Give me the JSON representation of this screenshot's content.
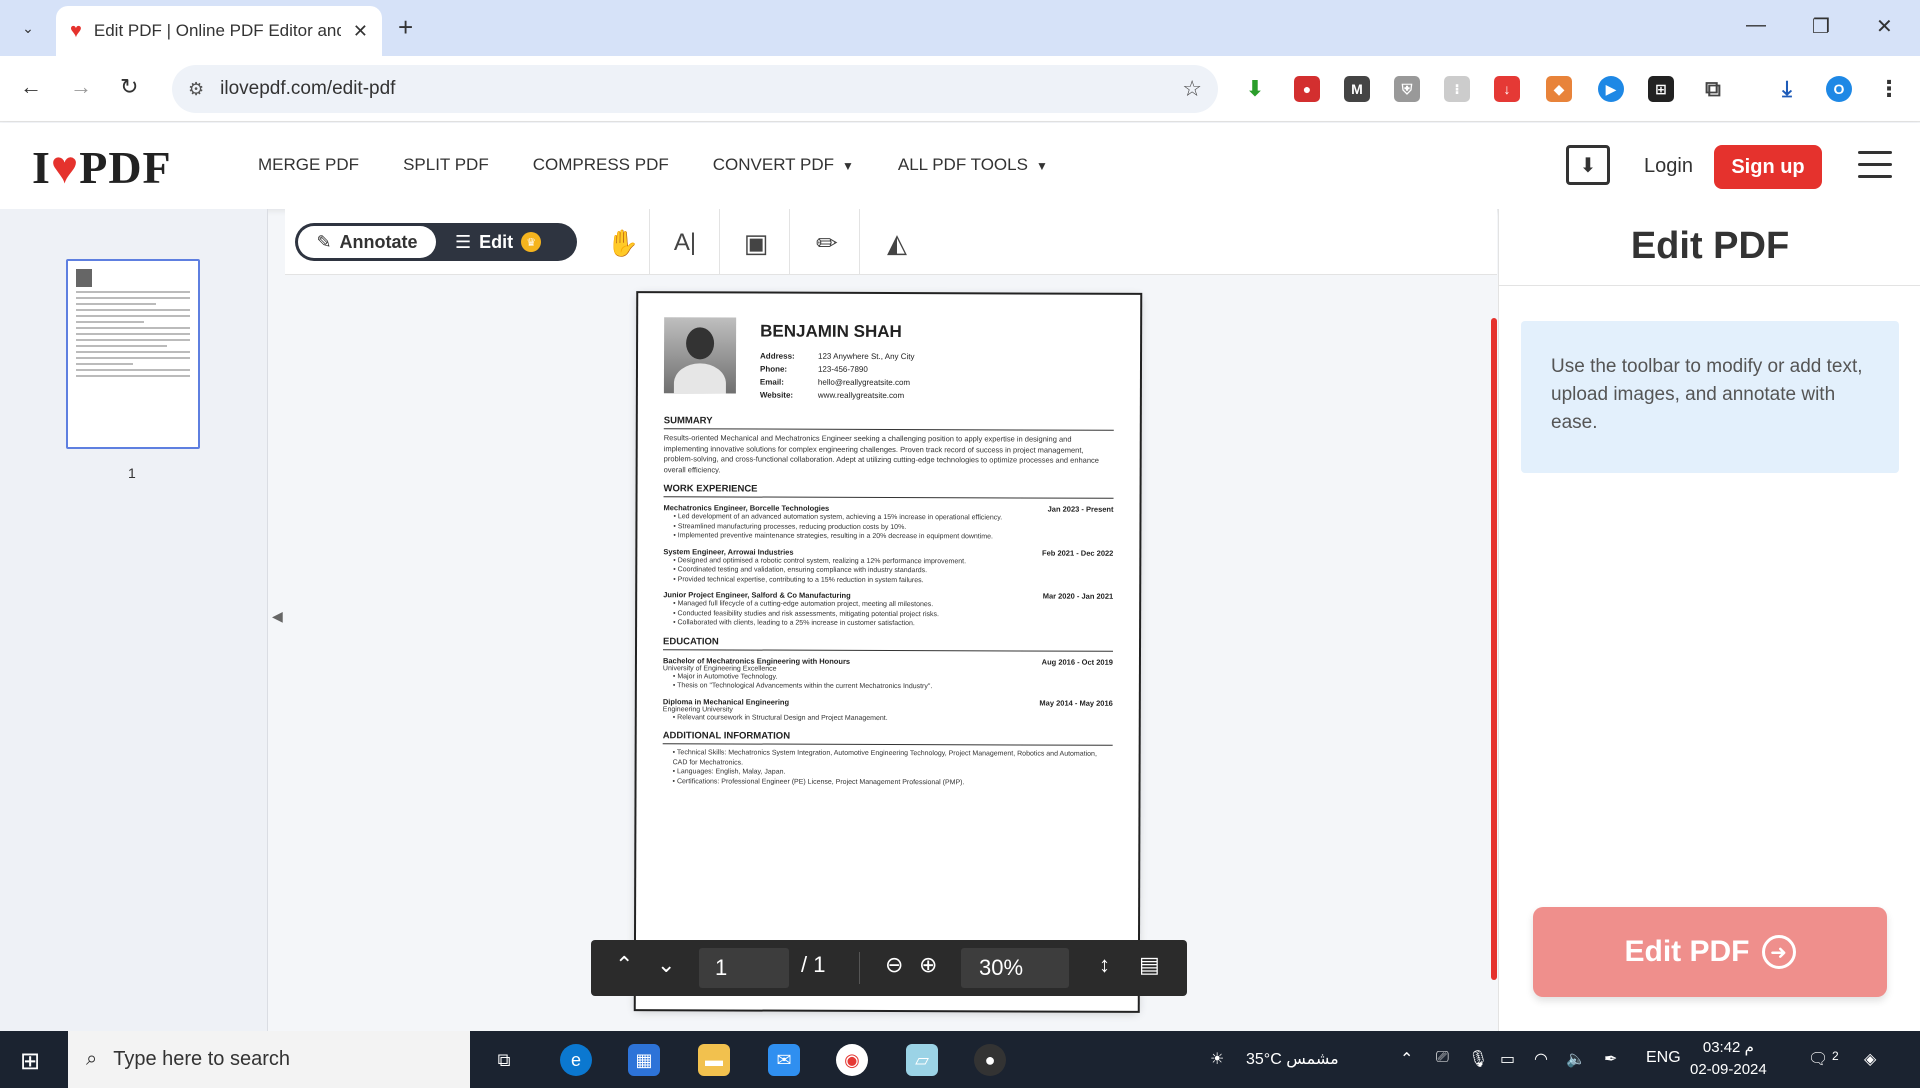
{
  "browser": {
    "tab_title": "Edit PDF | Online PDF Editor and",
    "url": "ilovepdf.com/edit-pdf",
    "profile_initial": "O"
  },
  "site": {
    "logo_text": "I PDF",
    "nav": [
      "MERGE PDF",
      "SPLIT PDF",
      "COMPRESS PDF",
      "CONVERT PDF",
      "ALL PDF TOOLS"
    ],
    "login": "Login",
    "signup": "Sign up"
  },
  "thumbs": {
    "page_number": "1"
  },
  "toolbar": {
    "annotate": "Annotate",
    "edit": "Edit"
  },
  "resume": {
    "name": "BENJAMIN SHAH",
    "contact": [
      {
        "k": "Address:",
        "v": "123 Anywhere St., Any City"
      },
      {
        "k": "Phone:",
        "v": "123-456-7890"
      },
      {
        "k": "Email:",
        "v": "hello@reallygreatsite.com"
      },
      {
        "k": "Website:",
        "v": "www.reallygreatsite.com"
      }
    ],
    "summary_title": "SUMMARY",
    "summary": "Results-oriented Mechanical and Mechatronics Engineer seeking a challenging position to apply expertise in designing and implementing innovative solutions for complex engineering challenges. Proven track record of success in project management, problem-solving, and cross-functional collaboration. Adept at utilizing cutting-edge technologies to optimize processes and enhance overall efficiency.",
    "work_title": "WORK EXPERIENCE",
    "jobs": [
      {
        "title": "Mechatronics Engineer, Borcelle Technologies",
        "date": "Jan 2023 - Present",
        "bullets": [
          "Led development of an advanced automation system, achieving a 15% increase in operational efficiency.",
          "Streamlined manufacturing processes, reducing production costs by 10%.",
          "Implemented preventive maintenance strategies, resulting in a 20% decrease in equipment downtime."
        ]
      },
      {
        "title": "System Engineer, Arrowai Industries",
        "date": "Feb 2021 - Dec 2022",
        "bullets": [
          "Designed and optimised a robotic control system, realizing a 12% performance improvement.",
          "Coordinated testing and validation, ensuring compliance with industry standards.",
          "Provided technical expertise, contributing to a 15% reduction in system failures."
        ]
      },
      {
        "title": "Junior Project Engineer, Salford & Co Manufacturing",
        "date": "Mar 2020 - Jan 2021",
        "bullets": [
          "Managed full lifecycle of a cutting-edge automation project, meeting all milestones.",
          "Conducted feasibility studies and risk assessments, mitigating potential project risks.",
          "Collaborated with clients, leading to a 25% increase in customer satisfaction."
        ]
      }
    ],
    "education_title": "EDUCATION",
    "education": [
      {
        "title": "Bachelor of Mechatronics Engineering with Honours",
        "date": "Aug 2016 - Oct 2019",
        "school": "University of Engineering Excellence",
        "bullets": [
          "Major in Automotive Technology.",
          "Thesis on \"Technological Advancements within the current Mechatronics Industry\"."
        ]
      },
      {
        "title": "Diploma in Mechanical Engineering",
        "date": "May 2014 - May 2016",
        "school": "Engineering University",
        "bullets": [
          "Relevant coursework in Structural Design and Project Management."
        ]
      }
    ],
    "additional_title": "ADDITIONAL INFORMATION",
    "additional": [
      "Technical Skills: Mechatronics System Integration, Automotive Engineering Technology, Project Management, Robotics and Automation, CAD for Mechatronics.",
      "Languages: English, Malay, Japan.",
      "Certifications: Professional Engineer (PE) License, Project Management Professional (PMP)."
    ]
  },
  "pager": {
    "current": "1",
    "total": "/ 1",
    "zoom": "30%"
  },
  "panel": {
    "title": "Edit PDF",
    "info": "Use the toolbar to modify or add text, upload images, and annotate with ease.",
    "button": "Edit PDF"
  },
  "taskbar": {
    "search_placeholder": "Type here to search",
    "weather": "35°C  مشمس",
    "lang": "ENG",
    "time": "03:42 م",
    "date": "02-09-2024",
    "notif_count": "2"
  },
  "colors": {
    "brand": "#e5322d",
    "panel_info_bg": "#e3f0fc",
    "button_faded": "#ef8f8c"
  }
}
